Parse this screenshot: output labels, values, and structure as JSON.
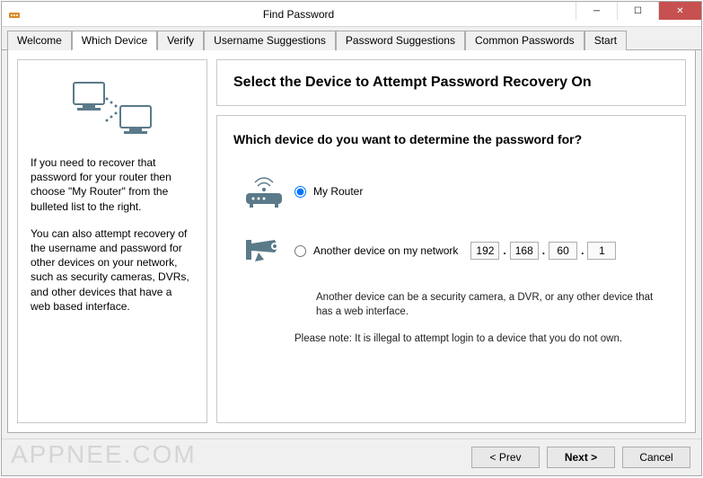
{
  "window": {
    "title": "Find Password"
  },
  "tabs": [
    {
      "label": "Welcome"
    },
    {
      "label": "Which Device"
    },
    {
      "label": "Verify"
    },
    {
      "label": "Username Suggestions"
    },
    {
      "label": "Password Suggestions"
    },
    {
      "label": "Common Passwords"
    },
    {
      "label": "Start"
    }
  ],
  "active_tab_index": 1,
  "left": {
    "p1": "If you need to recover that password for your router then choose \"My Router\" from the bulleted list to the right.",
    "p2": "You can also attempt recovery of the username and password for other devices on your network, such as security cameras, DVRs, and other devices that have a web based interface."
  },
  "main": {
    "heading": "Select the Device to Attempt Password Recovery On",
    "question": "Which device do you want to determine the password for?",
    "option_router": "My Router",
    "option_other": "Another device on my network",
    "ip": {
      "o1": "192",
      "o2": "168",
      "o3": "60",
      "o4": "1"
    },
    "note1": "Another device can be a security camera, a DVR, or any other device that has a web interface.",
    "note2": "Please note: It is illegal to attempt login to a device that you do not own."
  },
  "footer": {
    "prev": "< Prev",
    "next": "Next >",
    "cancel": "Cancel"
  },
  "watermark": "APPNEE.COM"
}
